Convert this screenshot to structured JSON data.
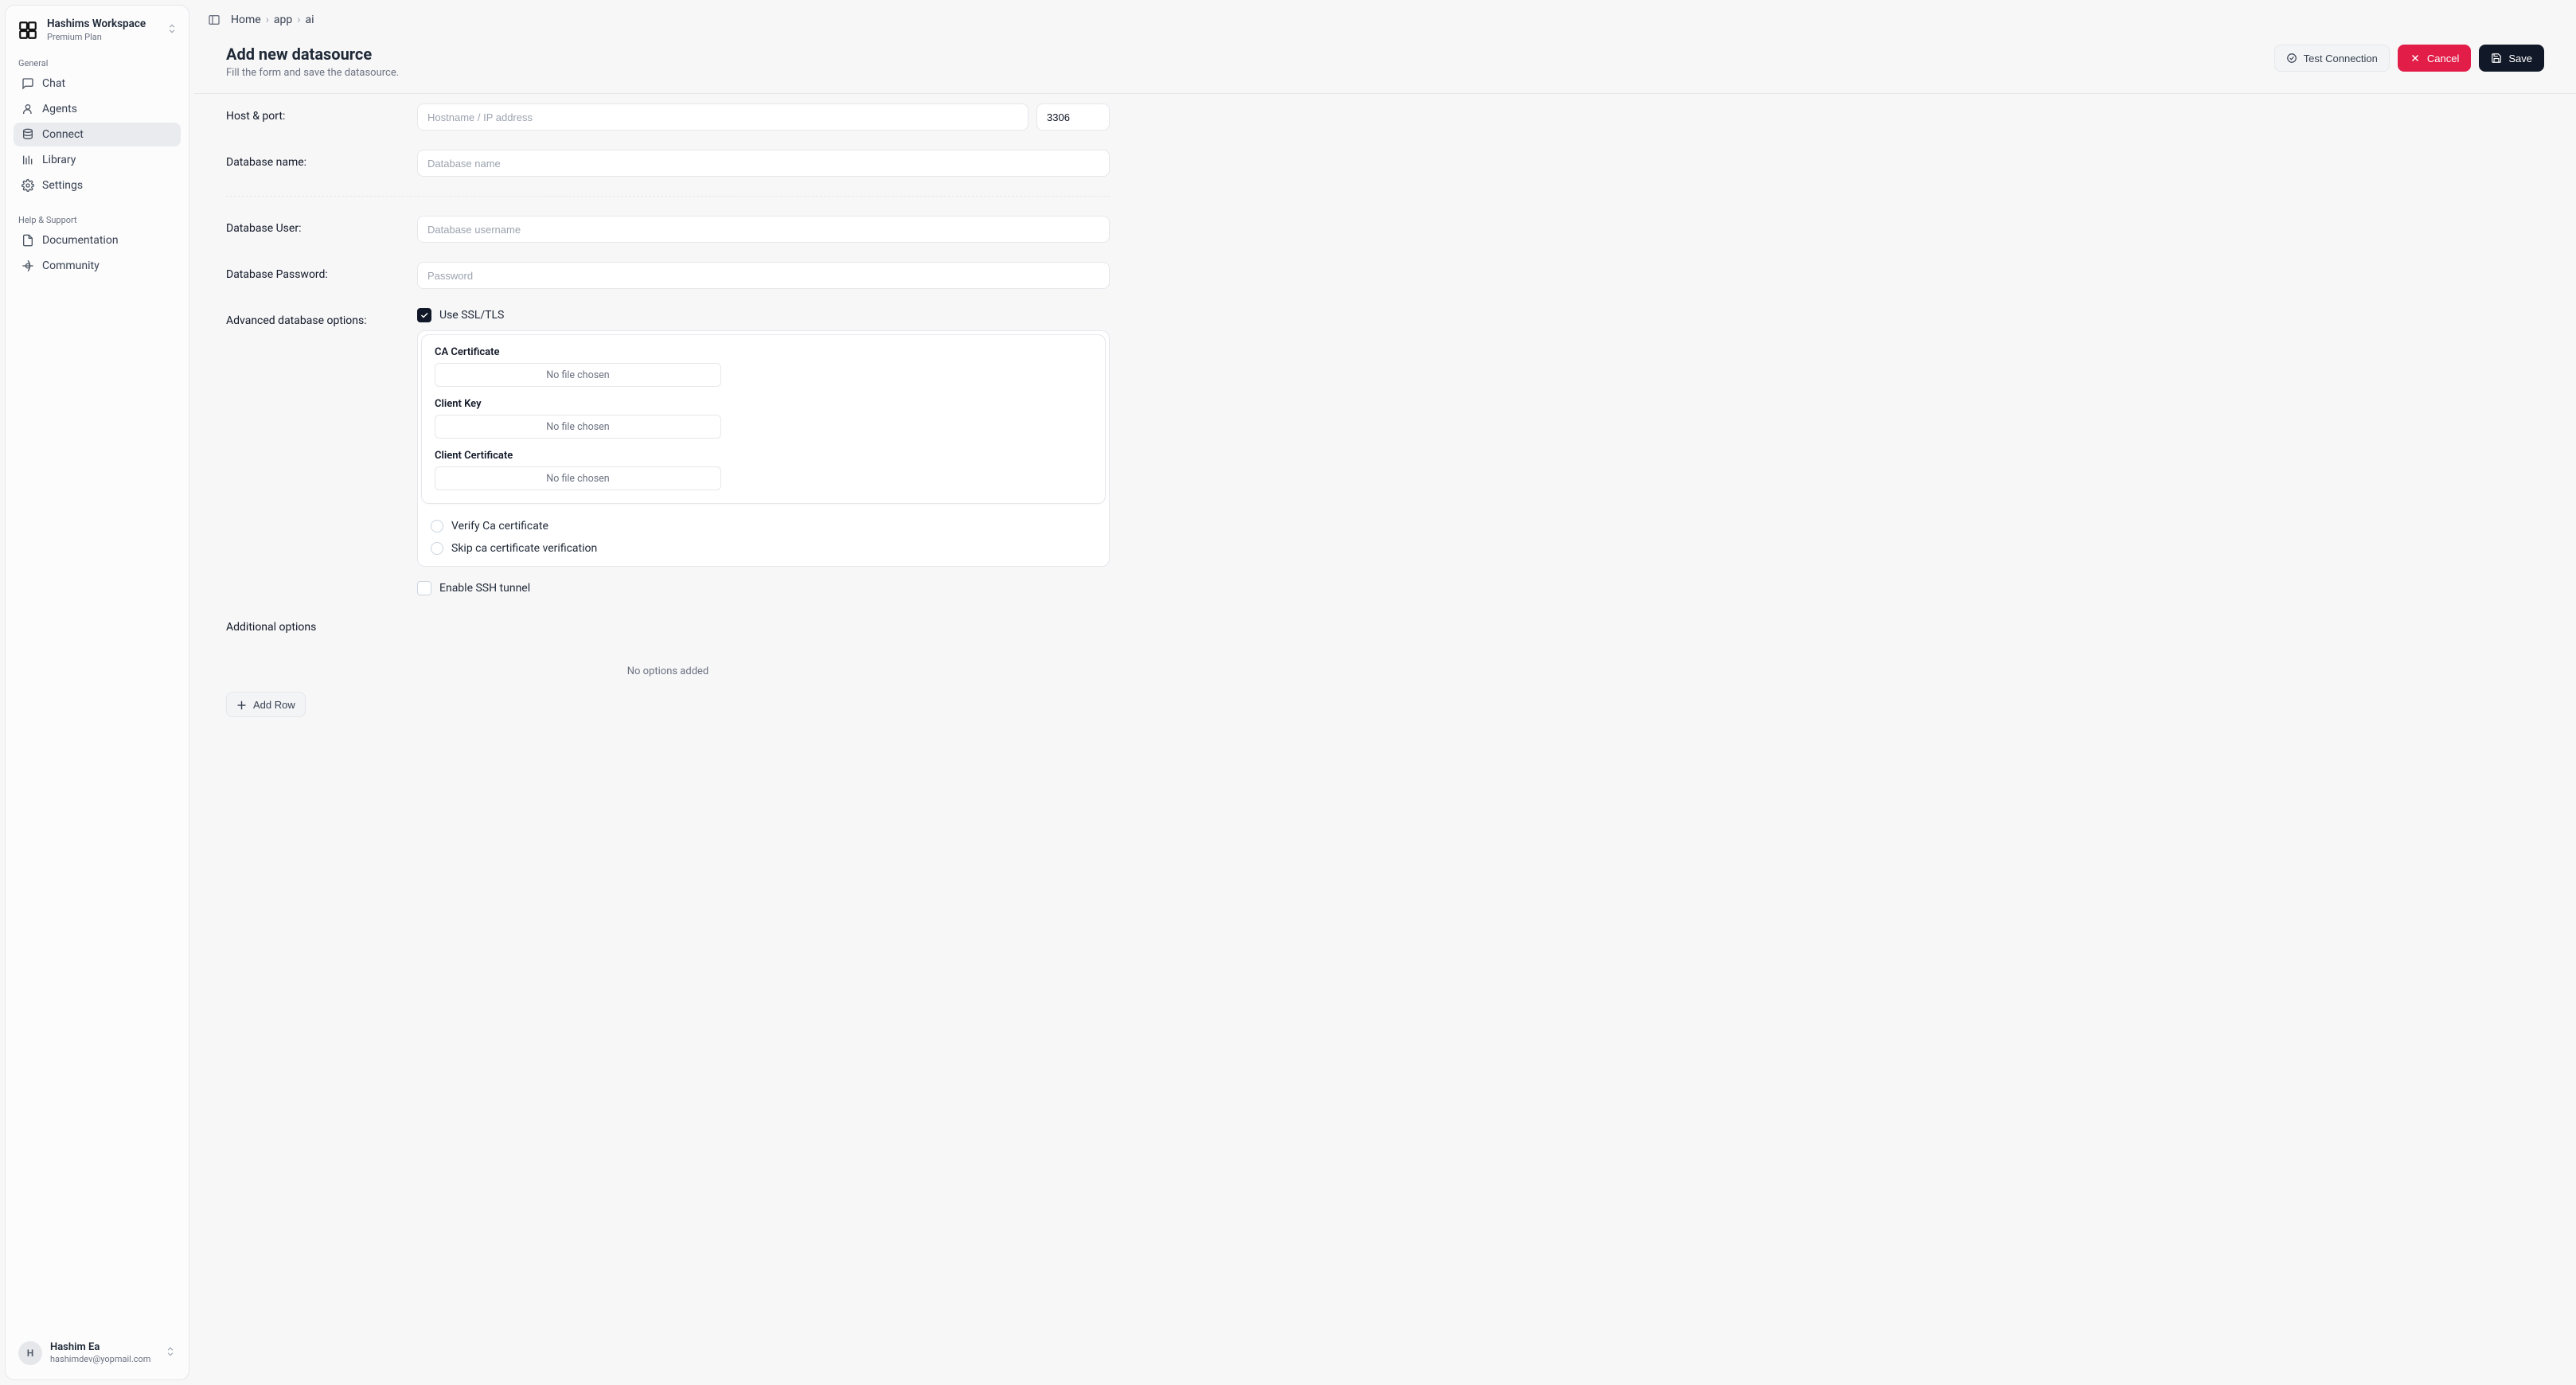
{
  "workspace": {
    "name": "Hashims Workspace",
    "plan": "Premium Plan"
  },
  "sidebar": {
    "section_general": "General",
    "items": [
      {
        "label": "Chat",
        "icon": "chat-icon",
        "active": false
      },
      {
        "label": "Agents",
        "icon": "agents-icon",
        "active": false
      },
      {
        "label": "Connect",
        "icon": "connect-icon",
        "active": true
      },
      {
        "label": "Library",
        "icon": "library-icon",
        "active": false
      },
      {
        "label": "Settings",
        "icon": "settings-icon",
        "active": false
      }
    ],
    "section_help": "Help & Support",
    "help_items": [
      {
        "label": "Documentation",
        "icon": "doc-icon"
      },
      {
        "label": "Community",
        "icon": "community-icon"
      }
    ]
  },
  "user": {
    "initial": "H",
    "name": "Hashim Ea",
    "email": "hashimdev@yopmail.com"
  },
  "breadcrumbs": [
    "Home",
    "app",
    "ai"
  ],
  "page": {
    "title": "Add new datasource",
    "subtitle": "Fill the form and save the datasource.",
    "actions": {
      "test": "Test Connection",
      "cancel": "Cancel",
      "save": "Save"
    }
  },
  "form": {
    "host_label": "Host & port:",
    "host_placeholder": "Hostname / IP address",
    "port_value": "3306",
    "dbname_label": "Database name:",
    "dbname_placeholder": "Database name",
    "dbuser_label": "Database User:",
    "dbuser_placeholder": "Database username",
    "dbpass_label": "Database Password:",
    "dbpass_placeholder": "Password",
    "adv_label": "Advanced database options:",
    "ssl_checkbox_label": "Use SSL/TLS",
    "ssl_checked": true,
    "ssl": {
      "ca_label": "CA Certificate",
      "client_key_label": "Client Key",
      "client_cert_label": "Client Certificate",
      "file_placeholder": "No file chosen",
      "verify_label": "Verify Ca certificate",
      "skip_label": "Skip ca certificate verification"
    },
    "ssh_label": "Enable SSH tunnel",
    "ssh_checked": false,
    "additional_label": "Additional options",
    "no_options_text": "No options added",
    "add_row_label": "Add Row"
  }
}
